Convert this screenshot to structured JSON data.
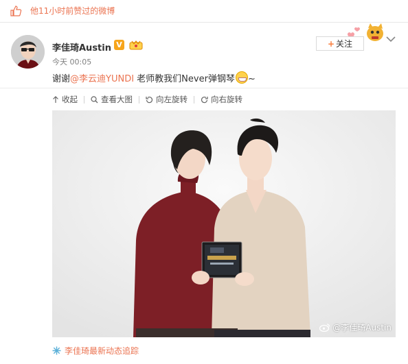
{
  "top_bar": {
    "liked_text": "他11小时前赞过的微博"
  },
  "post": {
    "username": "李佳琦Austin",
    "verified_badge": "V",
    "time": "今天 00:05",
    "text_before": "谢谢",
    "mention": "@李云迪YUNDI",
    "text_after": " 老师教我们Never弹钢琴",
    "text_tail": "~",
    "follow_label": "关注",
    "follow_plus": "+"
  },
  "toolbar": {
    "collapse": "收起",
    "view_large": "查看大图",
    "rotate_left": "向左旋转",
    "rotate_right": "向右旋转"
  },
  "image": {
    "watermark": "@李佳琦Austin"
  },
  "footer": {
    "link_text": "李佳琦最新动态追踪"
  },
  "colors": {
    "accent": "#eb7350",
    "badge": "#f7a51c",
    "follow_plus": "#fa7d3c"
  },
  "icons": [
    "thumb-up-icon",
    "vip-icon",
    "grin-emoji-icon",
    "chevron-down-icon",
    "collapse-arrow-icon",
    "magnifier-icon",
    "rotate-left-icon",
    "rotate-right-icon",
    "weibo-logo-icon",
    "sparkle-icon"
  ]
}
